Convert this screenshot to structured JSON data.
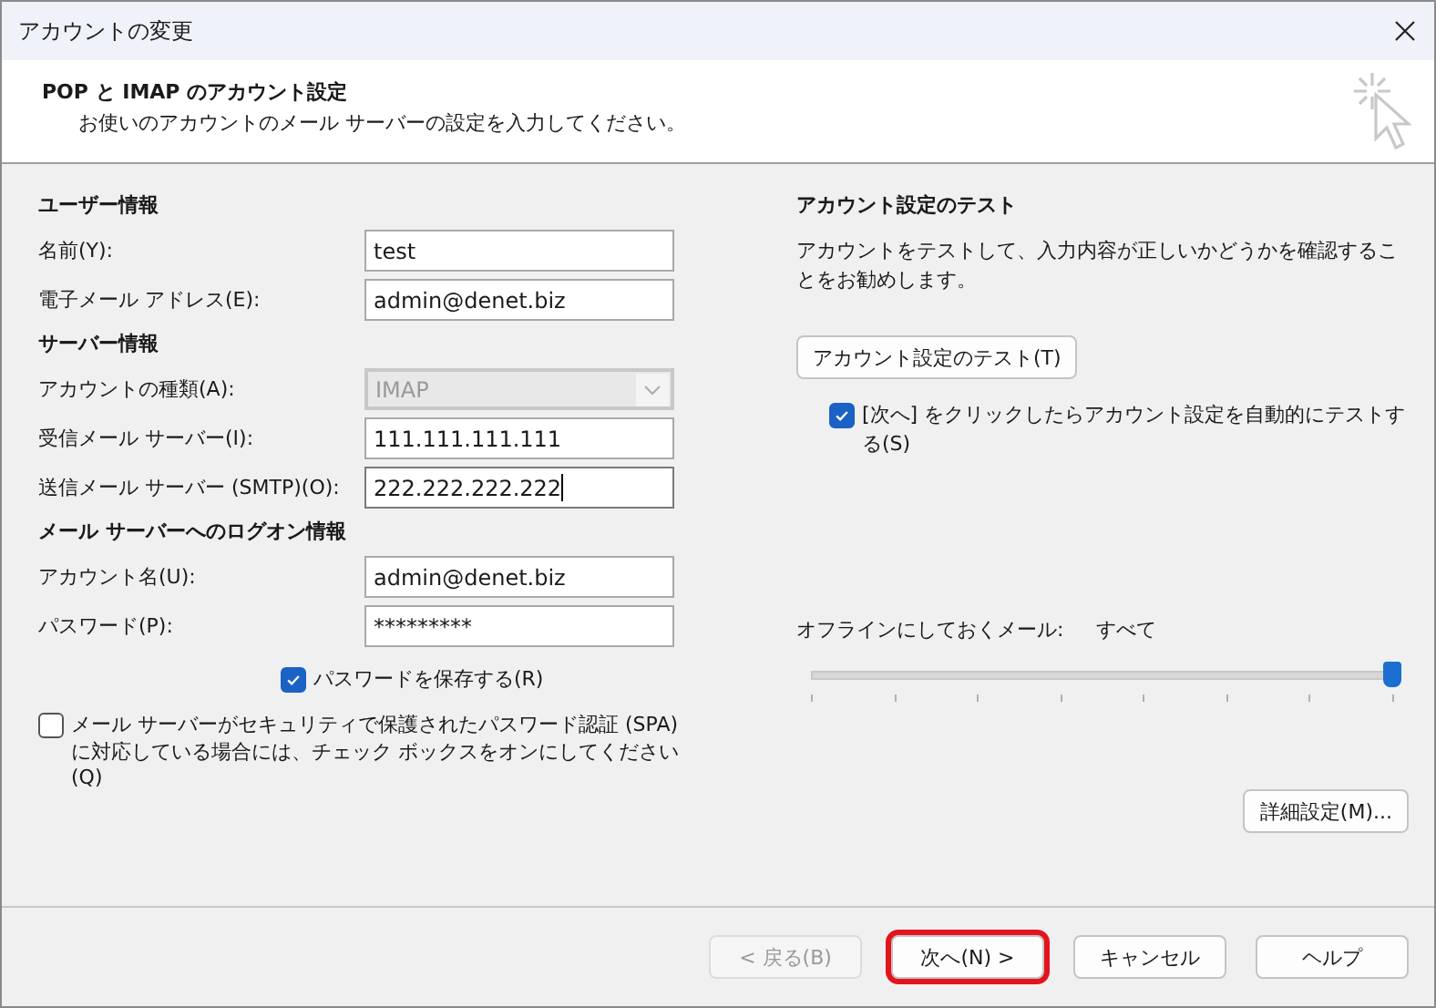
{
  "window": {
    "title": "アカウントの変更"
  },
  "header": {
    "title": "POP と IMAP のアカウント設定",
    "subtitle": "お使いのアカウントのメール サーバーの設定を入力してください。"
  },
  "left_sections": [
    {
      "heading": "ユーザー情報",
      "fields": [
        {
          "kind": "text",
          "label": "名前(Y):",
          "value": "test",
          "focused": false
        },
        {
          "kind": "text",
          "label": "電子メール アドレス(E):",
          "value": "admin@denet.biz",
          "focused": false
        }
      ]
    },
    {
      "heading": "サーバー情報",
      "fields": [
        {
          "kind": "dropdown",
          "label": "アカウントの種類(A):",
          "value": "IMAP",
          "disabled": true
        },
        {
          "kind": "text",
          "label": "受信メール サーバー(I):",
          "value": "111.111.111.111",
          "focused": false
        },
        {
          "kind": "text",
          "label": "送信メール サーバー (SMTP)(O):",
          "value": "222.222.222.222",
          "focused": true
        }
      ]
    },
    {
      "heading": "メール サーバーへのログオン情報",
      "fields": [
        {
          "kind": "text",
          "label": "アカウント名(U):",
          "value": "admin@denet.biz",
          "focused": false
        },
        {
          "kind": "text",
          "label": "パスワード(P):",
          "value": "*********",
          "focused": false
        }
      ]
    }
  ],
  "save_password": {
    "label": "パスワードを保存する(R)",
    "checked": true
  },
  "spa": {
    "label": "メール サーバーがセキュリティで保護されたパスワード認証 (SPA) に対応している場合には、チェック ボックスをオンにしてください(Q)",
    "checked": false
  },
  "test_section": {
    "heading": "アカウント設定のテスト",
    "description": "アカウントをテストして、入力内容が正しいかどうかを確認することをお勧めします。",
    "button": "アカウント設定のテスト(T)",
    "auto_test": {
      "label": "[次へ] をクリックしたらアカウント設定を自動的にテストする(S)",
      "checked": true
    }
  },
  "offline": {
    "label": "オフラインにしておくメール:",
    "value": "すべて",
    "level": 1
  },
  "advanced_button": "詳細設定(M)...",
  "footer_buttons": [
    {
      "label": "< 戻る(B)",
      "disabled": true,
      "highlighted": false
    },
    {
      "label": "次へ(N) >",
      "disabled": false,
      "highlighted": true
    },
    {
      "label": "キャンセル",
      "disabled": false,
      "highlighted": false
    },
    {
      "label": "ヘルプ",
      "disabled": false,
      "highlighted": false
    }
  ]
}
